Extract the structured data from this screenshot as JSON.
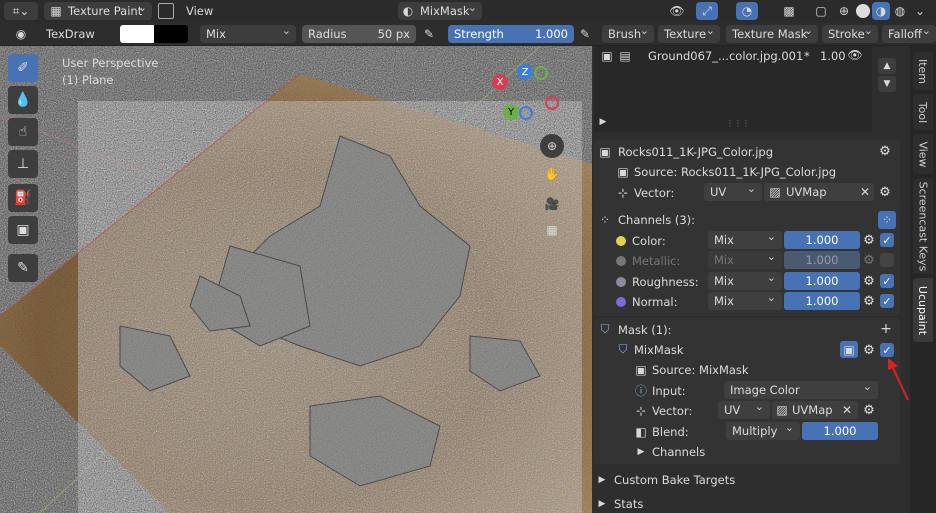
{
  "header": {
    "mode": "Texture Paint",
    "view": "View",
    "mask_selector": "MixMask"
  },
  "toolbar": {
    "brush_name": "TexDraw",
    "blend": "Mix",
    "radius_label": "Radius",
    "radius_value": "50 px",
    "strength_label": "Strength",
    "strength_value": "1.000",
    "brush": "Brush",
    "texture": "Texture",
    "texture_mask": "Texture Mask",
    "stroke": "Stroke",
    "falloff": "Falloff"
  },
  "viewport": {
    "perspective": "User Perspective",
    "object": "(1) Plane",
    "gizmo": {
      "x": "X",
      "y": "Y",
      "z": "Z"
    }
  },
  "panel": {
    "layer_row": {
      "name": "Ground067_...color.jpg.001",
      "flag": "*",
      "opacity": "1.00"
    },
    "image_title": "Rocks011_1K-JPG_Color.jpg",
    "source_label": "Source:",
    "source_value": "Rocks011_1K-JPG_Color.jpg",
    "vector_label": "Vector:",
    "vector_mode": "UV",
    "vector_map": "UVMap",
    "channels_header": "Channels (3):",
    "channels": [
      {
        "label": "Color:",
        "blend": "Mix",
        "value": "1.000",
        "dim": false
      },
      {
        "label": "Metallic:",
        "blend": "Mix",
        "value": "1.000",
        "dim": true
      },
      {
        "label": "Roughness:",
        "blend": "Mix",
        "value": "1.000",
        "dim": false
      },
      {
        "label": "Normal:",
        "blend": "Mix",
        "value": "1.000",
        "dim": false
      }
    ],
    "mask_header": "Mask (1):",
    "mask_name": "MixMask",
    "mask_source": "Source: MixMask",
    "input_label": "Input:",
    "input_value": "Image Color",
    "mask_vector_label": "Vector:",
    "mask_vector_mode": "UV",
    "mask_vector_map": "UVMap",
    "blend_label": "Blend:",
    "blend_value": "Multiply",
    "blend_factor": "1.000",
    "channels_label": "Channels",
    "custom_bake": "Custom Bake Targets",
    "stats": "Stats"
  },
  "side_tabs": [
    "Item",
    "Tool",
    "View",
    "Screencast Keys",
    "Ucupaint"
  ],
  "colors": {
    "accent": "#4772b3",
    "arrow": "#e02020"
  }
}
